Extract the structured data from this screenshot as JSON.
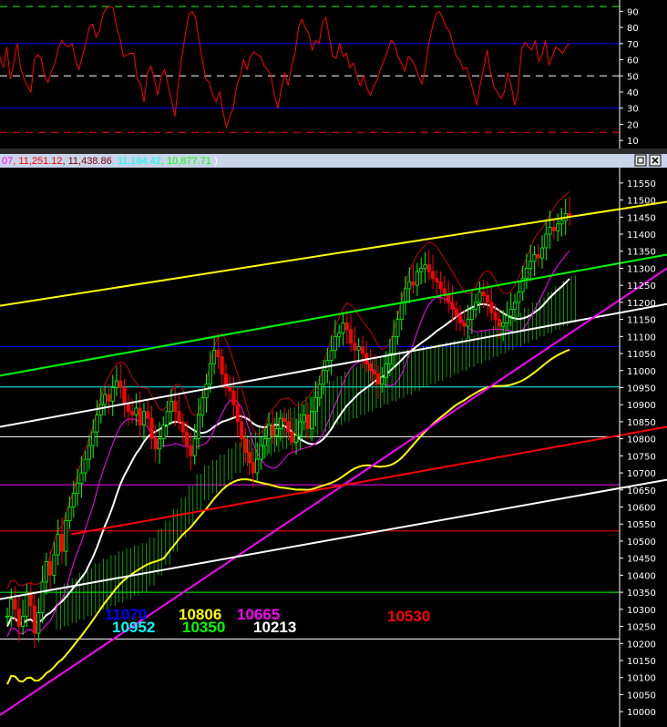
{
  "colors": {
    "background": "#000000",
    "grid_blue": "#0000ff",
    "rsi_line": "#ff0000",
    "candle_up": "#00ff00",
    "candle_down": "#ff0000",
    "cloud": "#00ff00",
    "axis_text": "#ffffff",
    "titlebar": "#c8d4e8"
  },
  "window": {
    "minimize_icon": "window-restore-icon",
    "close_icon": "window-close-icon"
  },
  "header_values": [
    {
      "text": "07",
      "color": "#ff00ff"
    },
    {
      "text": "11,251.12",
      "color": "#ff0000"
    },
    {
      "text": "11,438.86",
      "color": "#800000"
    },
    {
      "text": "11,184.42",
      "color": "#00ffff"
    },
    {
      "text": "10,877.71",
      "color": "#00ff00"
    },
    {
      "text": ")",
      "color": "#ffffff"
    }
  ],
  "chart_data": [
    {
      "type": "line",
      "panel": "rsi",
      "y_ticks": [
        "90",
        "80",
        "70",
        "60",
        "50",
        "40",
        "30",
        "20",
        "10"
      ],
      "ylim": [
        5,
        97
      ],
      "reference_levels": [
        {
          "value": 93,
          "color": "#00ff00",
          "style": "dashed"
        },
        {
          "value": 70,
          "color": "#0000ff",
          "style": "solid"
        },
        {
          "value": 50,
          "color": "#ffffff",
          "style": "dashed"
        },
        {
          "value": 30,
          "color": "#0000ff",
          "style": "solid"
        },
        {
          "value": 15,
          "color": "#ff0000",
          "style": "dashed"
        }
      ],
      "series": [
        {
          "color": "#ff0000",
          "values": [
            62,
            55,
            68,
            48,
            58,
            70,
            55,
            48,
            44,
            40,
            60,
            63,
            61,
            50,
            46,
            53,
            58,
            67,
            72,
            69,
            68,
            70,
            60,
            54,
            62,
            70,
            80,
            82,
            74,
            78,
            88,
            92,
            93,
            92,
            80,
            73,
            62,
            63,
            64,
            64,
            48,
            45,
            34,
            52,
            56,
            48,
            38,
            50,
            54,
            44,
            35,
            25,
            45,
            62,
            75,
            88,
            90,
            86,
            72,
            60,
            48,
            46,
            38,
            34,
            40,
            28,
            18,
            25,
            30,
            44,
            50,
            60,
            54,
            62,
            65,
            63,
            62,
            56,
            54,
            50,
            38,
            30,
            42,
            52,
            44,
            56,
            64,
            80,
            85,
            80,
            76,
            66,
            72,
            70,
            83,
            86,
            74,
            62,
            61,
            70,
            62,
            64,
            55,
            58,
            50,
            44,
            50,
            42,
            38,
            44,
            48,
            55,
            60,
            66,
            72,
            70,
            62,
            58,
            53,
            62,
            60,
            56,
            50,
            45,
            55,
            70,
            80,
            88,
            90,
            86,
            80,
            78,
            70,
            62,
            60,
            54,
            55,
            48,
            40,
            32,
            45,
            55,
            66,
            52,
            43,
            40,
            36,
            40,
            52,
            44,
            32,
            40,
            66,
            71,
            68,
            66,
            72,
            59,
            63,
            72,
            57,
            62,
            68,
            66,
            64,
            68,
            70
          ]
        }
      ]
    },
    {
      "type": "candlestick",
      "panel": "price",
      "y_ticks": [
        "11550",
        "11500",
        "11450",
        "11400",
        "11350",
        "11300",
        "11250",
        "11200",
        "11150",
        "11100",
        "11050",
        "11000",
        "10950",
        "10900",
        "10850",
        "10800",
        "10750",
        "10700",
        "10650",
        "10600",
        "10550",
        "10500",
        "10450",
        "10400",
        "10350",
        "10300",
        "10250",
        "10200",
        "10150",
        "10100",
        "10050",
        "10000"
      ],
      "ylim": [
        9955,
        11595
      ],
      "horizontal_levels": [
        {
          "value": 11070,
          "color": "#0000ff"
        },
        {
          "value": 10952,
          "color": "#00ffff"
        },
        {
          "value": 10806,
          "color": "#ffffff"
        },
        {
          "value": 10665,
          "color": "#ff00ff"
        },
        {
          "value": 10530,
          "color": "#ff0000"
        },
        {
          "value": 10350,
          "color": "#00ff00"
        },
        {
          "value": 10213,
          "color": "#ffffff"
        }
      ],
      "level_labels": [
        {
          "text": "11070",
          "color": "#0000ff"
        },
        {
          "text": "10952",
          "color": "#00ffff"
        },
        {
          "text": "10806",
          "color": "#ffff00"
        },
        {
          "text": "10350",
          "color": "#00ff00"
        },
        {
          "text": "10665",
          "color": "#ff00ff"
        },
        {
          "text": "10213",
          "color": "#ffffff"
        },
        {
          "text": "10530",
          "color": "#ff0000"
        }
      ],
      "trendlines": [
        {
          "color": "#ffff00",
          "from": [
            0,
            11190
          ],
          "to": [
            168,
            11495
          ]
        },
        {
          "color": "#00ff00",
          "from": [
            0,
            10985
          ],
          "to": [
            168,
            11340
          ]
        },
        {
          "color": "#ffffff",
          "from": [
            0,
            10835
          ],
          "to": [
            168,
            11195
          ]
        },
        {
          "color": "#ff00ff",
          "from": [
            0,
            9990
          ],
          "to": [
            168,
            11300
          ]
        },
        {
          "color": "#ff0000",
          "from": [
            18,
            10520
          ],
          "to": [
            168,
            10835
          ]
        },
        {
          "color": "#ffffff",
          "from": [
            0,
            10330
          ],
          "to": [
            168,
            10680
          ]
        }
      ],
      "closes": [
        10280,
        10330,
        10300,
        10250,
        10280,
        10350,
        10310,
        10230,
        10290,
        10380,
        10440,
        10400,
        10460,
        10520,
        10470,
        10560,
        10600,
        10640,
        10670,
        10700,
        10740,
        10780,
        10820,
        10870,
        10900,
        10930,
        10910,
        10950,
        10970,
        10950,
        10900,
        10880,
        10870,
        10890,
        10840,
        10880,
        10860,
        10800,
        10770,
        10800,
        10840,
        10880,
        10910,
        10880,
        10850,
        10820,
        10780,
        10750,
        10800,
        10870,
        10920,
        10960,
        11020,
        11060,
        11040,
        10990,
        10950,
        10940,
        10900,
        10850,
        10800,
        10760,
        10730,
        10700,
        10740,
        10780,
        10800,
        10840,
        10810,
        10830,
        10860,
        10850,
        10820,
        10790,
        10810,
        10850,
        10870,
        10830,
        10880,
        10920,
        10960,
        11000,
        11030,
        11060,
        11100,
        11110,
        11140,
        11120,
        11080,
        11060,
        11070,
        11050,
        11020,
        11000,
        10990,
        10960,
        10980,
        11020,
        11050,
        11100,
        11150,
        11200,
        11240,
        11260,
        11250,
        11290,
        11300,
        11310,
        11290,
        11270,
        11260,
        11240,
        11220,
        11200,
        11180,
        11160,
        11140,
        11130,
        11150,
        11180,
        11200,
        11230,
        11220,
        11200,
        11170,
        11150,
        11130,
        11140,
        11160,
        11180,
        11200,
        11230,
        11270,
        11300,
        11320,
        11340,
        11330,
        11360,
        11400,
        11420,
        11410,
        11430,
        11440,
        11460,
        11450
      ],
      "ichimoku_base": [
        10300,
        10310,
        10320,
        10330,
        10340,
        10350,
        10360,
        10370,
        10380,
        10390,
        10400,
        10410,
        10430,
        10460,
        10490,
        10530,
        10570,
        10610,
        10650,
        10680,
        10700,
        10720,
        10740,
        10760,
        10780,
        10790,
        10800,
        10810,
        10820,
        10830,
        10840,
        10850,
        10860,
        10870,
        10880,
        10890,
        10900,
        10910,
        10920,
        10930,
        10940,
        10950,
        10960,
        10970,
        10980,
        10990,
        11000,
        11010,
        11020,
        11030,
        11040,
        11050,
        11060,
        11070,
        11080,
        11090,
        11100,
        11110,
        11120,
        11130,
        11140,
        11150,
        11160,
        11170,
        11180,
        11190,
        11200
      ]
    }
  ]
}
